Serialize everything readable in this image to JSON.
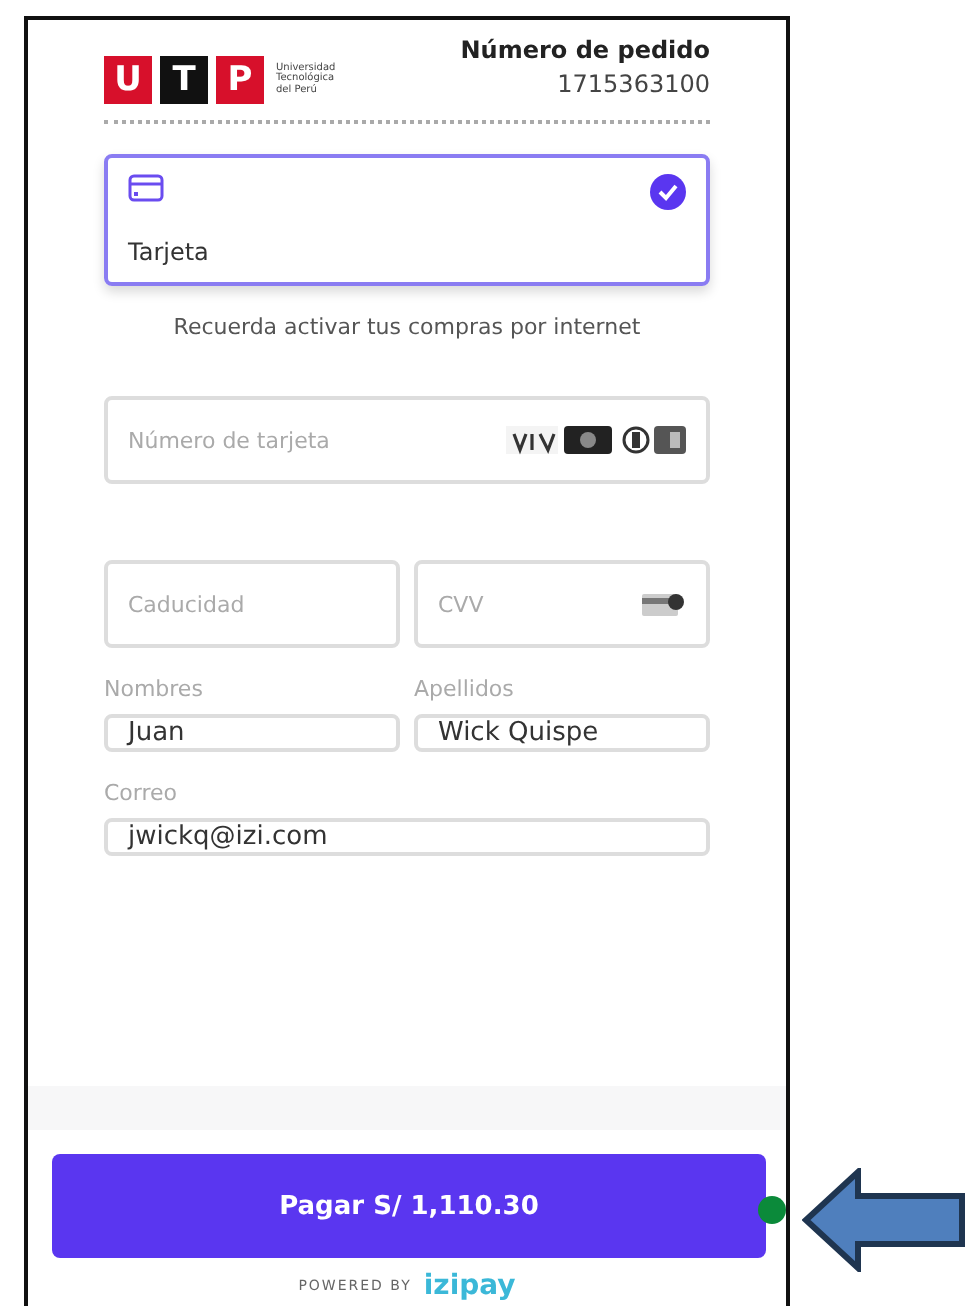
{
  "header": {
    "logo_letters": [
      "U",
      "T",
      "P"
    ],
    "logo_caption": "Universidad Tecnológica del Perú",
    "order_label": "Número de pedido",
    "order_number": "1715363100"
  },
  "payment_methods": [
    {
      "label": "Tarjeta",
      "selected": true
    }
  ],
  "note": "Recuerda activar tus compras por internet",
  "card_fields": [
    {
      "kind": "number",
      "placeholder": "Número de tarjeta"
    },
    {
      "kind": "expiry",
      "placeholder": "Caducidad"
    },
    {
      "kind": "cvv",
      "placeholder": "CVV"
    }
  ],
  "person_fields": [
    {
      "label": "Nombres",
      "value": "Juan"
    },
    {
      "label": "Apellidos",
      "value": "Wick Quispe"
    },
    {
      "label": "Correo",
      "value": "jwickq@izi.com"
    }
  ],
  "pay_button": "Pagar S/ 1,110.30",
  "powered_by": {
    "text": "POWERED BY",
    "brand": "izipay"
  }
}
